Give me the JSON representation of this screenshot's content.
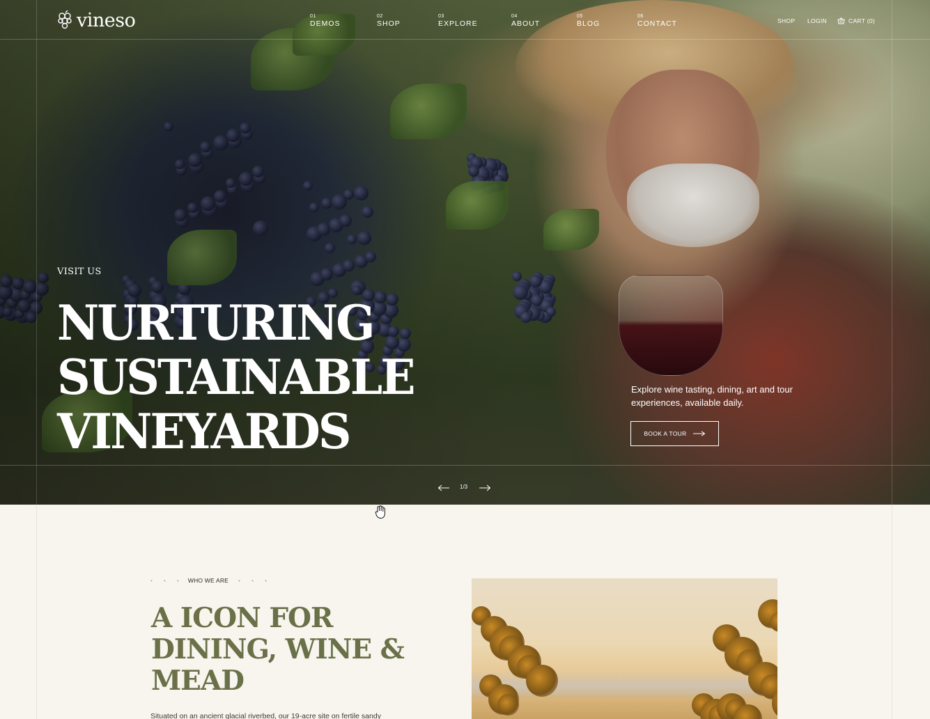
{
  "brand": {
    "name": "vineso"
  },
  "nav": [
    {
      "num": "01",
      "label": "DEMOS"
    },
    {
      "num": "02",
      "label": "SHOP"
    },
    {
      "num": "03",
      "label": "EXPLORE"
    },
    {
      "num": "04",
      "label": "ABOUT"
    },
    {
      "num": "05",
      "label": "BLOG"
    },
    {
      "num": "06",
      "label": "CONTACT"
    }
  ],
  "utility": {
    "shop": "SHOP",
    "login": "LOGIN",
    "cart": "CART (0)"
  },
  "hero": {
    "eyebrow": "VISIT US",
    "title_lines": [
      "NURTURING",
      "SUSTAINABLE",
      "VINEYARDS"
    ],
    "description": "Explore wine tasting, dining, art and tour experiences, available daily.",
    "cta": "BOOK A TOUR",
    "slide_counter": "1/3"
  },
  "about": {
    "eyebrow": "WHO WE ARE",
    "dots": "• • •",
    "title": "A ICON FOR DINING, WINE & MEAD",
    "description": "Situated on an ancient glacial riverbed, our 19-acre site on fertile sandy"
  },
  "colors": {
    "accent": "#6a7047",
    "background": "#f7f5ee",
    "text": "#2a2a22"
  },
  "icons": [
    "grape-logo-icon",
    "cart-icon",
    "arrow-right-icon",
    "arrow-left-icon",
    "hand-cursor-icon"
  ]
}
